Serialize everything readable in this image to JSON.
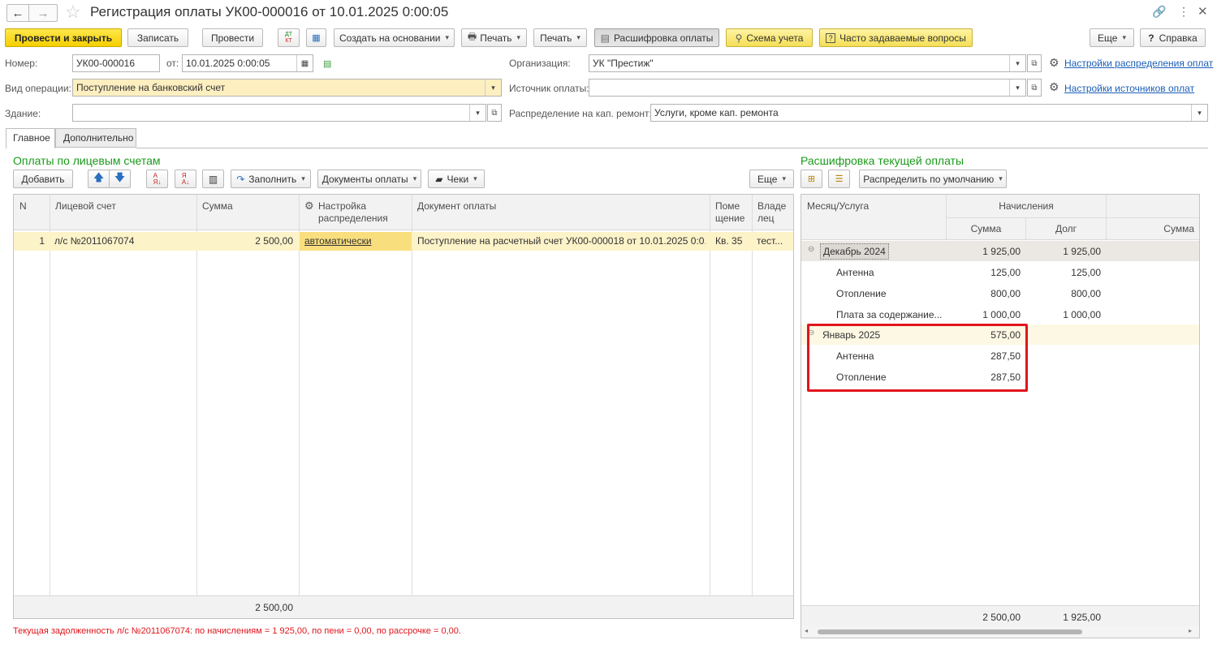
{
  "window": {
    "title": "Регистрация оплаты УК00-000016 от 10.01.2025 0:00:05"
  },
  "toolbar": {
    "post_close": "Провести и закрыть",
    "save": "Записать",
    "post": "Провести",
    "create_based": "Создать на основании",
    "print1": "Печать",
    "print2": "Печать",
    "breakdown": "Расшифровка оплаты",
    "scheme": "Схема учета",
    "faq": "Часто задаваемые вопросы",
    "more": "Еще",
    "help": "Справка"
  },
  "header": {
    "number_label": "Номер:",
    "number_value": "УК00-000016",
    "date_label": "от:",
    "date_value": "10.01.2025  0:00:05",
    "op_label": "Вид операции:",
    "op_value": "Поступление на банковский счет",
    "building_label": "Здание:",
    "building_value": "",
    "org_label": "Организация:",
    "org_value": "УК \"Престиж\"",
    "source_label": "Источник оплаты:",
    "source_value": "",
    "cap_label": "Распределение на кап. ремонт:",
    "cap_value": "Услуги, кроме кап. ремонта",
    "link_distribution": "Настройки распределения оплат",
    "link_sources": "Настройки источников оплат"
  },
  "tabs": [
    {
      "label": "Главное"
    },
    {
      "label": "Дополнительно"
    }
  ],
  "left": {
    "title": "Оплаты по лицевым счетам",
    "add": "Добавить",
    "fill": "Заполнить",
    "pay_docs": "Документы оплаты",
    "checks": "Чеки",
    "more": "Еще",
    "columns": {
      "n": "N",
      "account": "Лицевой счет",
      "sum": "Сумма",
      "setting": "Настройка распределения",
      "doc": "Документ оплаты",
      "room": "Поме щение",
      "owner": "Владе лец"
    },
    "rows": [
      {
        "n": "1",
        "account": "л/с №2011067074",
        "sum": "2 500,00",
        "setting": "автоматически",
        "doc": "Поступление на расчетный счет УК00-000018 от 10.01.2025 0:0...",
        "room": "Кв. 35",
        "owner": "тест..."
      }
    ],
    "total_sum": "2 500,00"
  },
  "right": {
    "title": "Расшифровка текущей оплаты",
    "distribute": "Распределить по умолчанию",
    "columns": {
      "month": "Месяц/Услуга",
      "accruals": "Начисления",
      "sum": "Сумма",
      "debt": "Долг",
      "sum2": "Сумма"
    },
    "rows": [
      {
        "name": "Декабрь 2024",
        "sum": "1 925,00",
        "debt": "1 925,00"
      },
      {
        "name": "Антенна",
        "sum": "125,00",
        "debt": "125,00"
      },
      {
        "name": "Отопление",
        "sum": "800,00",
        "debt": "800,00"
      },
      {
        "name": "Плата за содержание...",
        "sum": "1 000,00",
        "debt": "1 000,00"
      },
      {
        "name": "Январь 2025",
        "sum": "575,00",
        "debt": ""
      },
      {
        "name": "Антенна",
        "sum": "287,50",
        "debt": ""
      },
      {
        "name": "Отопление",
        "sum": "287,50",
        "debt": ""
      }
    ],
    "total_sum": "2 500,00",
    "total_debt": "1 925,00"
  },
  "status": {
    "text": "Текущая задолженность л/с №2011067074: по начислениям = 1 925,00, по пени = 0,00, по рассрочке = 0,00."
  },
  "colors": {
    "accent_green": "#1a9a1a",
    "highlight_red": "#e0151b",
    "selection": "#fdf3c9"
  }
}
